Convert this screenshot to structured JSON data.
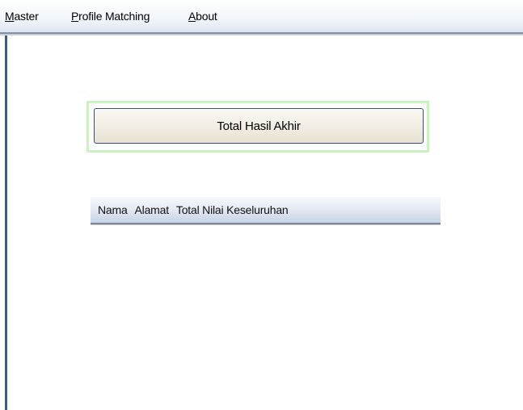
{
  "menubar": {
    "items": [
      {
        "mnemonic": "M",
        "rest": "aster"
      },
      {
        "mnemonic": "P",
        "rest": "rofile Matching"
      },
      {
        "mnemonic": "A",
        "rest": "bout"
      }
    ]
  },
  "main": {
    "total_button_label": "Total Hasil Akhir",
    "table": {
      "columns": [
        "Nama",
        "Alamat",
        "Total Nilai Keseluruhan"
      ]
    }
  },
  "colors": {
    "focus_frame": "#c9f3c1",
    "window_edge": "#3e5d86",
    "button_border": "#3b4b73"
  }
}
